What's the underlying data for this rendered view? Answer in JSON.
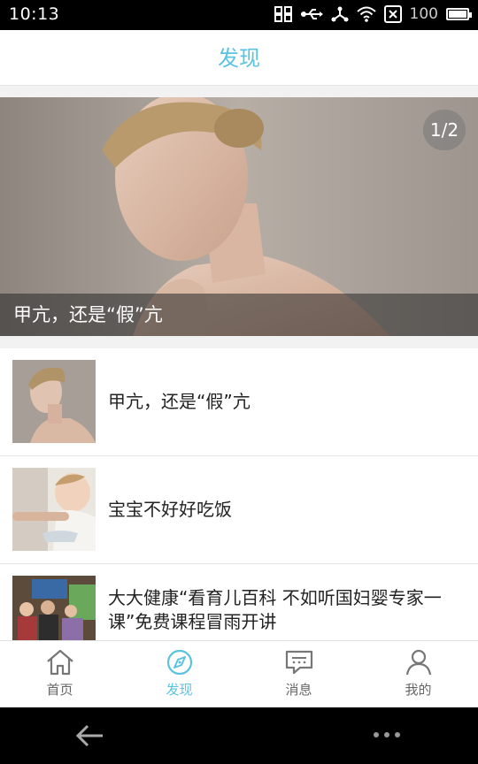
{
  "status": {
    "time": "10:13",
    "battery": "100"
  },
  "header": {
    "title": "发现"
  },
  "banner": {
    "counter": "1/2",
    "caption": "甲亢，还是“假”亢"
  },
  "articles": [
    {
      "title": "甲亢，还是“假”亢"
    },
    {
      "title": "宝宝不好好吃饭"
    },
    {
      "title": "大大健康“看育儿百科 不如听国妇婴专家一课”免费课程冒雨开讲"
    }
  ],
  "tabs": [
    {
      "label": "首页",
      "icon": "home-icon"
    },
    {
      "label": "发现",
      "icon": "compass-icon"
    },
    {
      "label": "消息",
      "icon": "message-icon"
    },
    {
      "label": "我的",
      "icon": "user-icon"
    }
  ],
  "colors": {
    "accent": "#5bc2df",
    "tab_inactive": "#666666"
  }
}
